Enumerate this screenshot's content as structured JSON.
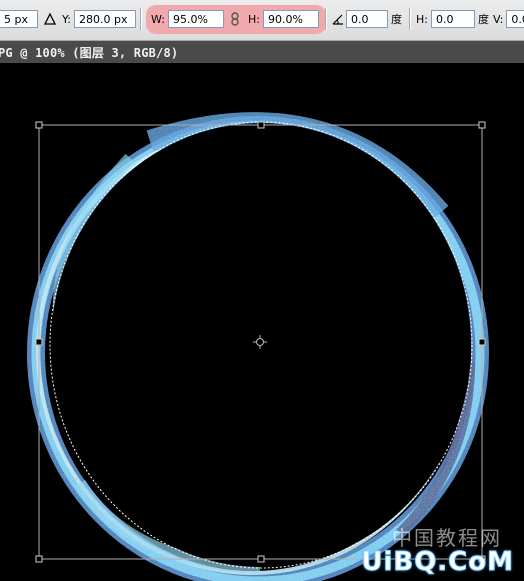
{
  "options_bar": {
    "x_value_partial": "5 px",
    "y_label": "Y:",
    "y_value": "280.0 px",
    "w_label": "W:",
    "w_value": "95.0%",
    "h_label": "H:",
    "h_value": "90.0%",
    "angle_value": "0.0",
    "angle_unit": "度",
    "skew_h_label": "H:",
    "skew_h_value": "0.0",
    "skew_h_unit": "度",
    "skew_v_label": "V:",
    "skew_v_value": "0.0",
    "highlight_color": "#f2a9ad"
  },
  "document": {
    "title": "PG @ 100% (图层 3, RGB/8)"
  },
  "canvas": {
    "background": "#000000",
    "ring_color": "#4fc3ff"
  },
  "watermark": {
    "chinese": "中国教程网",
    "site": "UiBQ.CoM"
  }
}
